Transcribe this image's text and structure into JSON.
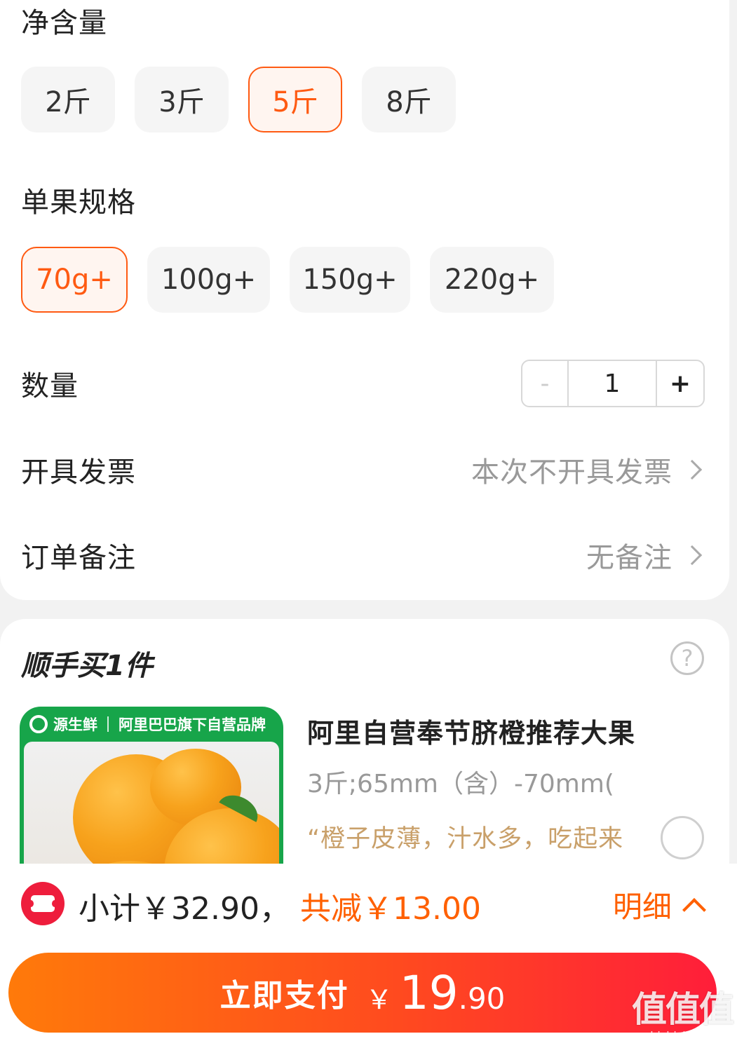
{
  "net_weight": {
    "title": "净含量",
    "options": [
      "2斤",
      "3斤",
      "5斤",
      "8斤"
    ],
    "selected_index": 2
  },
  "fruit_size": {
    "title": "单果规格",
    "options": [
      "70g+",
      "100g+",
      "150g+",
      "220g+"
    ],
    "selected_index": 0
  },
  "quantity": {
    "label": "数量",
    "minus": "-",
    "value": "1",
    "plus": "+"
  },
  "invoice": {
    "label": "开具发票",
    "value": "本次不开具发票"
  },
  "remark": {
    "label": "订单备注",
    "value": "无备注"
  },
  "addon": {
    "title": "顺手买1件",
    "help": "?",
    "brand_name": "源生鲜",
    "brand_tagline": "阿里巴巴旗下自营品牌",
    "product_name": "阿里自营奉节脐橙推荐大果",
    "product_spec": "3斤;65mm（含）-70mm(",
    "product_quote": "“橙子皮薄，汁水多，吃起来"
  },
  "summary": {
    "subtotal": "小计￥32.90，",
    "discount": "共减￥13.00",
    "detail": "明细"
  },
  "pay": {
    "label": "立即支付",
    "currency": "￥",
    "integer": "19",
    "decimal": ".90"
  },
  "watermark": {
    "logo": "值值值",
    "url": "zhizhizhi.com"
  },
  "colors": {
    "accent": "#ff5a12",
    "discount": "#ff6000",
    "coupon": "#ee1d3c",
    "brand_green": "#17a54a"
  }
}
